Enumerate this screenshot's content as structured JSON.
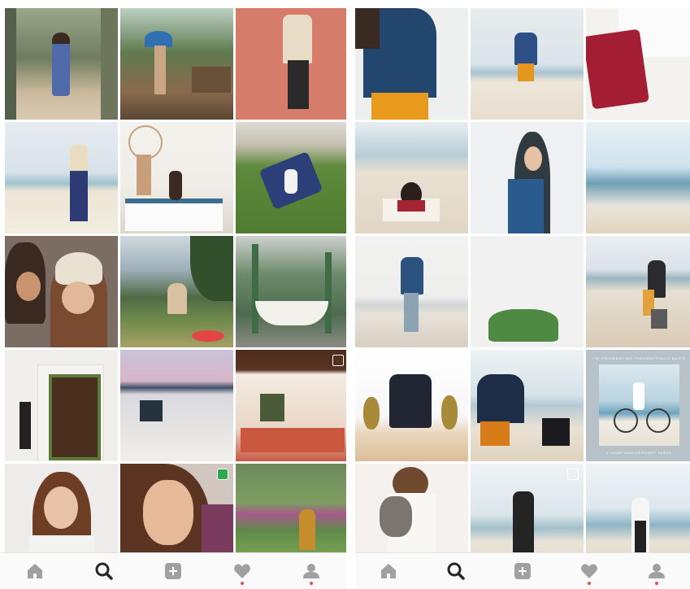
{
  "colors": {
    "tab_icon": "#a0a0a0",
    "tab_icon_active": "#262626",
    "notification_dot": "#ed4956",
    "tabbar_bg": "#fafafa"
  },
  "tabbar": {
    "items": [
      {
        "icon": "home-icon",
        "active": false
      },
      {
        "icon": "search-icon",
        "active": true
      },
      {
        "icon": "add-post-icon",
        "active": false
      },
      {
        "icon": "heart-icon",
        "active": false,
        "notification": true
      },
      {
        "icon": "profile-icon",
        "active": false,
        "notification": true
      }
    ]
  },
  "right_grid": {
    "anniversary_tile": {
      "caption_top": "I'M CELEBRATING THOUGHTFULLY MAE'S",
      "caption_bottom": "2 YEAR ANNIVERSARY ISSUE"
    }
  }
}
